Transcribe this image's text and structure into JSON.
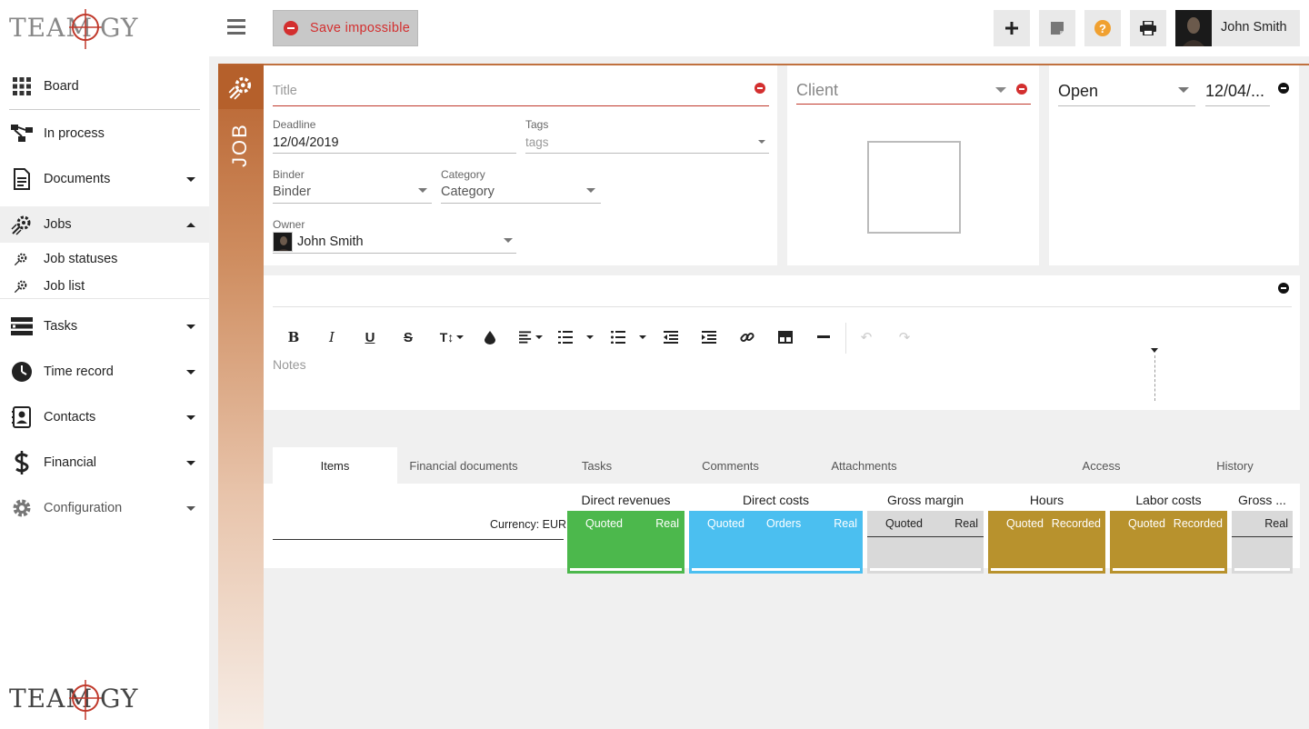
{
  "app": {
    "logo_text": "TEAMOGY"
  },
  "sidebar": {
    "items": [
      {
        "label": "Board",
        "icon": "grid-icon"
      },
      {
        "label": "In process",
        "icon": "workflow-icon"
      },
      {
        "label": "Documents",
        "icon": "document-icon"
      },
      {
        "label": "Jobs",
        "icon": "rocket-gear-icon"
      },
      {
        "label": "Job statuses",
        "icon": "rocket-gear-icon"
      },
      {
        "label": "Job list",
        "icon": "rocket-gear-icon"
      },
      {
        "label": "Tasks",
        "icon": "tasks-icon"
      },
      {
        "label": "Time record",
        "icon": "clock-icon"
      },
      {
        "label": "Contacts",
        "icon": "contacts-icon"
      },
      {
        "label": "Financial",
        "icon": "dollar-icon"
      },
      {
        "label": "Configuration",
        "icon": "gear-icon"
      }
    ]
  },
  "topbar": {
    "save_label": "Save impossible",
    "user_name": "John Smith"
  },
  "job": {
    "strip_label": "JOB",
    "title_placeholder": "Title",
    "deadline_label": "Deadline",
    "deadline_value": "12/04/2019",
    "tags_label": "Tags",
    "tags_placeholder": "tags",
    "binder_label": "Binder",
    "binder_value": "Binder",
    "category_label": "Category",
    "category_value": "Category",
    "owner_label": "Owner",
    "owner_value": "John Smith",
    "client_placeholder": "Client",
    "status_value": "Open",
    "status_date": "12/04/..."
  },
  "notes": {
    "placeholder": "Notes"
  },
  "tabs": [
    {
      "label": "Items",
      "active": true
    },
    {
      "label": "Financial documents"
    },
    {
      "label": "Tasks"
    },
    {
      "label": "Comments"
    },
    {
      "label": "Attachments"
    },
    {
      "label": "Access"
    },
    {
      "label": "History"
    }
  ],
  "items_summary": {
    "currency_label": "Currency: EUR",
    "groups": [
      {
        "title": "Direct revenues",
        "cols": [
          "Quoted",
          "Real"
        ],
        "color": "#4cb84c"
      },
      {
        "title": "Direct costs",
        "cols": [
          "Quoted",
          "Orders",
          "Real"
        ],
        "color": "#4bbff0"
      },
      {
        "title": "Gross margin",
        "cols": [
          "Quoted",
          "Real"
        ],
        "color": "#d9d9d9"
      },
      {
        "title": "Hours",
        "cols": [
          "Quoted",
          "Recorded"
        ],
        "color": "#b8922d"
      },
      {
        "title": "Labor costs",
        "cols": [
          "Quoted",
          "Recorded"
        ],
        "color": "#b8922d"
      },
      {
        "title": "Gross ...",
        "cols": [
          "Real"
        ],
        "color": "#d9d9d9"
      }
    ]
  }
}
